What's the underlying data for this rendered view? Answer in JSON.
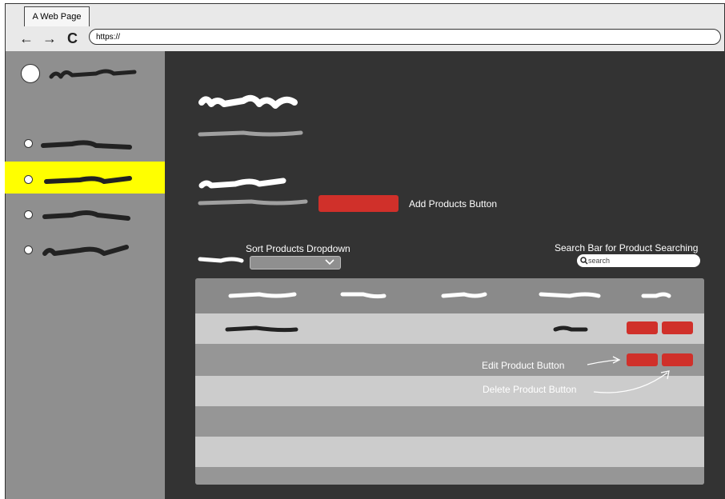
{
  "browser": {
    "tab_title": "A Web Page",
    "back": "←",
    "forward": "→",
    "reload": "C",
    "url": "https://"
  },
  "colors": {
    "sidebar_bg": "#8f8f8f",
    "main_bg": "#333333",
    "selected_highlight": "#ffff00",
    "button_red": "#d0302a",
    "table_header": "#8a8a8a",
    "row_light": "#cccccc",
    "row_dark": "#969696"
  },
  "annotations": {
    "add_products": "Add Products Button",
    "sort_dropdown": "Sort Products Dropdown",
    "search_bar": "Search Bar for Product Searching",
    "edit_product": "Edit Product Button",
    "delete_product": "Delete Product Button"
  },
  "search": {
    "placeholder": "search",
    "icon": "search-icon"
  },
  "dropdown": {
    "icon": "chevron-down-icon"
  },
  "sidebar": {
    "selected_index": 2
  }
}
